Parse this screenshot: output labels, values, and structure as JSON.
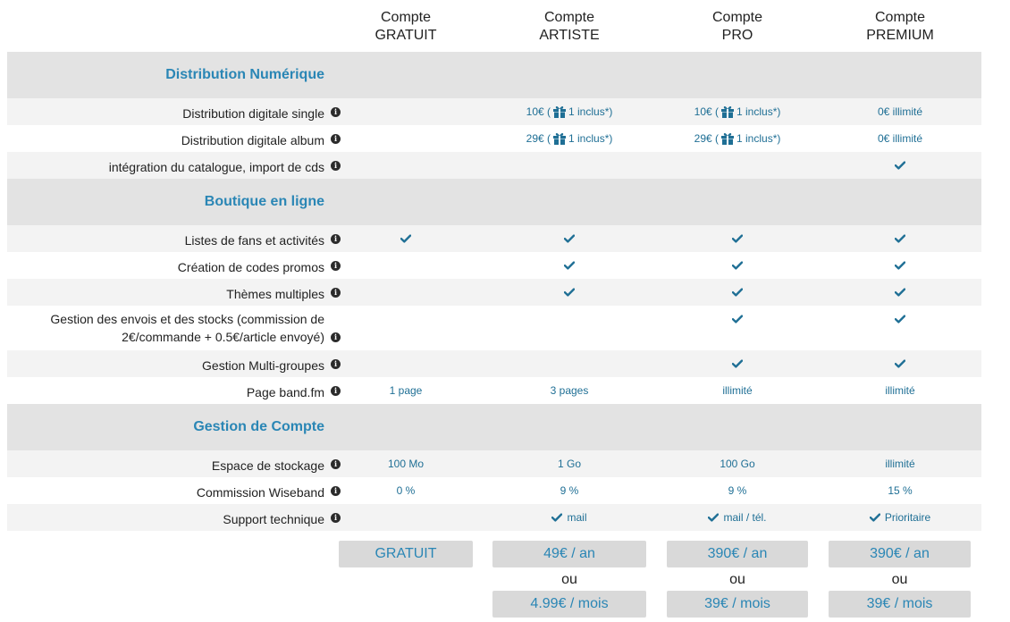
{
  "plans": [
    {
      "line1": "Compte",
      "line2": "GRATUIT"
    },
    {
      "line1": "Compte",
      "line2": "ARTISTE"
    },
    {
      "line1": "Compte",
      "line2": "PRO"
    },
    {
      "line1": "Compte",
      "line2": "PREMIUM"
    }
  ],
  "sections": {
    "distribution": "Distribution Numérique",
    "boutique": "Boutique en ligne",
    "compte": "Gestion de Compte"
  },
  "features": {
    "single": {
      "label": "Distribution digitale single",
      "c2_price": "10€ (",
      "c2_incl": "1 inclus*)",
      "c3_price": "10€ (",
      "c3_incl": "1 inclus*)",
      "c4": "0€ illimité"
    },
    "album": {
      "label": "Distribution digitale album",
      "c2_price": "29€ (",
      "c2_incl": "1 inclus*)",
      "c3_price": "29€ (",
      "c3_incl": "1 inclus*)",
      "c4": "0€ illimité"
    },
    "catalogue": {
      "label": "intégration du catalogue, import de cds"
    },
    "fans": {
      "label": "Listes de fans et activités"
    },
    "promos": {
      "label": "Création de codes promos"
    },
    "themes": {
      "label": "Thèmes multiples"
    },
    "envois": {
      "label_line1": "Gestion des envois et des stocks (commission de",
      "label_line2": "2€/commande + 0.5€/article envoyé)"
    },
    "multi": {
      "label": "Gestion Multi-groupes"
    },
    "page": {
      "label": "Page band.fm",
      "c1": "1 page",
      "c2": "3 pages",
      "c3": "illimité",
      "c4": "illimité"
    },
    "stockage": {
      "label": "Espace de stockage",
      "c1": "100 Mo",
      "c2": "1 Go",
      "c3": "100 Go",
      "c4": "illimité"
    },
    "commission": {
      "label": "Commission Wiseband",
      "c1": "0 %",
      "c2": "9 %",
      "c3": "9 %",
      "c4": "15 %"
    },
    "support": {
      "label": "Support technique",
      "c2": "mail",
      "c3": "mail / tél.",
      "c4": "Prioritaire"
    }
  },
  "info_glyph": "i",
  "prices": {
    "gratuit": "GRATUIT",
    "artiste_year": "49€ / an",
    "artiste_month": "4.99€ / mois",
    "pro_year": "390€ / an",
    "pro_month": "39€ / mois",
    "premium_year": "390€ / an",
    "premium_month": "39€ / mois",
    "or": "ou"
  },
  "colors": {
    "accent": "#2a86b5",
    "check": "#1f6f95",
    "section_bg": "#e3e3e3",
    "alt_row_bg": "#f3f3f3",
    "button_bg": "#d9d9d9"
  }
}
